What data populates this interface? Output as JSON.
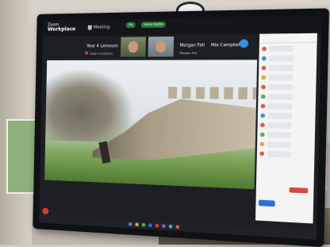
{
  "meeting_app": {
    "brand_top": "Zoom",
    "brand_name": "Workplace",
    "meeting_label": "Meeting"
  },
  "participants": {
    "presenter_title": "Year 4 Lemours",
    "presenter_sub": "Sage 4 Lemours",
    "member_a": "Morgan Fell",
    "member_a_sub": "Morgan Fell",
    "member_b": "Mia Campbell",
    "green_pill_left": "Ga",
    "green_pill_right": "Sasha Hadda"
  },
  "colors": {
    "brand_accent": "#2f6fd6",
    "recording_red": "#d63b2f",
    "active_speaker_green": "#2a7d3a"
  }
}
